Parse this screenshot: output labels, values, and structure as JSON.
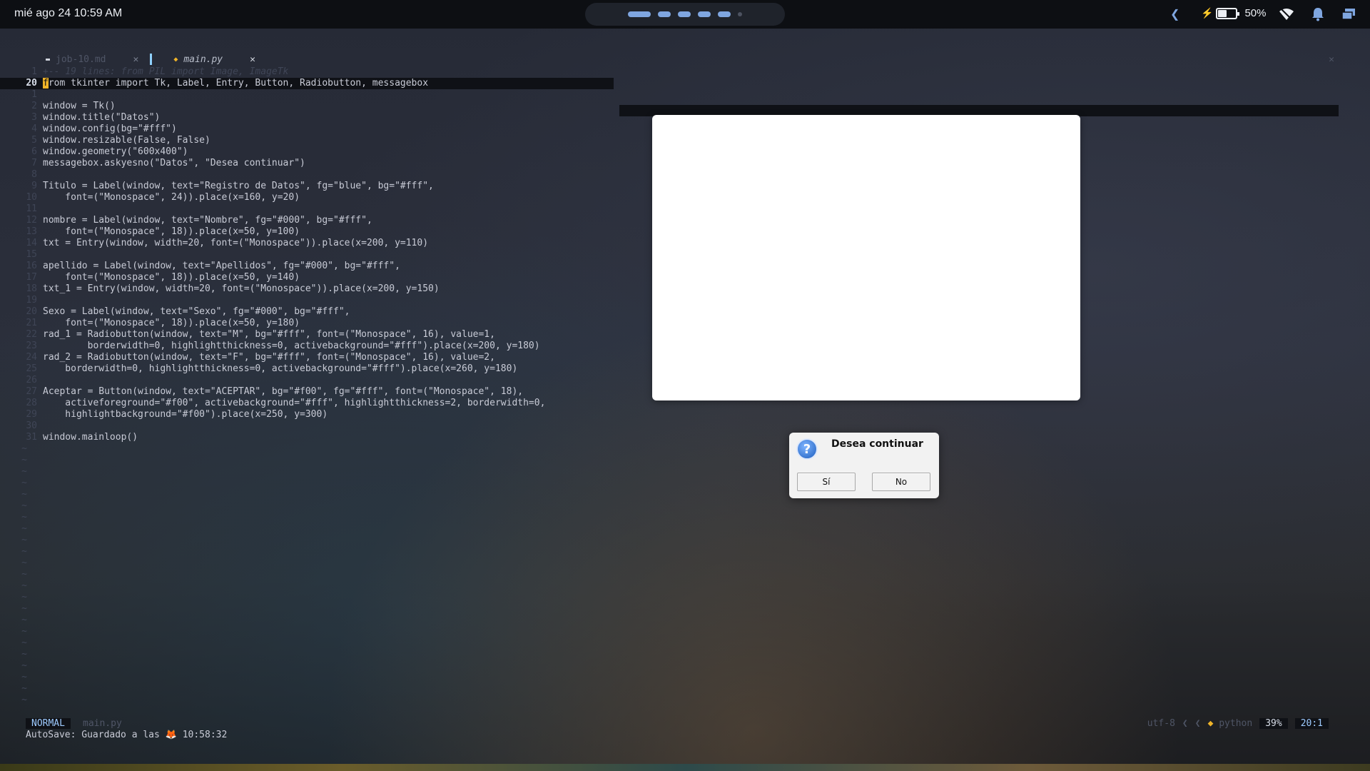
{
  "topbar": {
    "clock": "mié ago 24 10:59 AM",
    "battery_percent": "50%",
    "battery_level": 0.5,
    "workspaces": [
      "active",
      "normal",
      "normal",
      "normal",
      "normal",
      "empty"
    ]
  },
  "tabs": [
    {
      "label": "job-10.md",
      "close": "✕"
    },
    {
      "label": "main.py",
      "close": "✕"
    }
  ],
  "code_lines": [
    {
      "n": "1",
      "t": "+-- 19 lines: from PIL import Image, ImageTk",
      "folded": true
    },
    {
      "n": "20",
      "t": "from tkinter import Tk, Label, Entry, Button, Radiobutton, messagebox",
      "current": true
    },
    {
      "n": "1",
      "t": ""
    },
    {
      "n": "2",
      "t": "window = Tk()"
    },
    {
      "n": "3",
      "t": "window.title(\"Datos\")"
    },
    {
      "n": "4",
      "t": "window.config(bg=\"#fff\")"
    },
    {
      "n": "5",
      "t": "window.resizable(False, False)"
    },
    {
      "n": "6",
      "t": "window.geometry(\"600x400\")"
    },
    {
      "n": "7",
      "t": "messagebox.askyesno(\"Datos\", \"Desea continuar\")"
    },
    {
      "n": "8",
      "t": ""
    },
    {
      "n": "9",
      "t": "Titulo = Label(window, text=\"Registro de Datos\", fg=\"blue\", bg=\"#fff\","
    },
    {
      "n": "10",
      "t": "    font=(\"Monospace\", 24)).place(x=160, y=20)"
    },
    {
      "n": "11",
      "t": ""
    },
    {
      "n": "12",
      "t": "nombre = Label(window, text=\"Nombre\", fg=\"#000\", bg=\"#fff\","
    },
    {
      "n": "13",
      "t": "    font=(\"Monospace\", 18)).place(x=50, y=100)"
    },
    {
      "n": "14",
      "t": "txt = Entry(window, width=20, font=(\"Monospace\")).place(x=200, y=110)"
    },
    {
      "n": "15",
      "t": ""
    },
    {
      "n": "16",
      "t": "apellido = Label(window, text=\"Apellidos\", fg=\"#000\", bg=\"#fff\","
    },
    {
      "n": "17",
      "t": "    font=(\"Monospace\", 18)).place(x=50, y=140)"
    },
    {
      "n": "18",
      "t": "txt_1 = Entry(window, width=20, font=(\"Monospace\")).place(x=200, y=150)"
    },
    {
      "n": "19",
      "t": ""
    },
    {
      "n": "20",
      "t": "Sexo = Label(window, text=\"Sexo\", fg=\"#000\", bg=\"#fff\","
    },
    {
      "n": "21",
      "t": "    font=(\"Monospace\", 18)).place(x=50, y=180)"
    },
    {
      "n": "22",
      "t": "rad_1 = Radiobutton(window, text=\"M\", bg=\"#fff\", font=(\"Monospace\", 16), value=1,"
    },
    {
      "n": "23",
      "t": "        borderwidth=0, highlightthickness=0, activebackground=\"#fff\").place(x=200, y=180)"
    },
    {
      "n": "24",
      "t": "rad_2 = Radiobutton(window, text=\"F\", bg=\"#fff\", font=(\"Monospace\", 16), value=2,"
    },
    {
      "n": "25",
      "t": "    borderwidth=0, highlightthickness=0, activebackground=\"#fff\").place(x=260, y=180)"
    },
    {
      "n": "26",
      "t": ""
    },
    {
      "n": "27",
      "t": "Aceptar = Button(window, text=\"ACEPTAR\", bg=\"#f00\", fg=\"#fff\", font=(\"Monospace\", 18),"
    },
    {
      "n": "28",
      "t": "    activeforeground=\"#f00\", activebackground=\"#fff\", highlightthickness=2, borderwidth=0,"
    },
    {
      "n": "29",
      "t": "    highlightbackground=\"#f00\").place(x=250, y=300)"
    },
    {
      "n": "30",
      "t": ""
    },
    {
      "n": "31",
      "t": "window.mainloop()"
    }
  ],
  "tilde_rows": 23,
  "tilde": "~",
  "statusline": {
    "mode": "NORMAL",
    "file": "main.py",
    "encoding": "utf-8",
    "filetype": "python",
    "percent": "39%",
    "position": "20:1"
  },
  "cmdline": {
    "prefix": "AutoSave: Guardado a las",
    "emoji": "🦊",
    "time": "10:58:32"
  },
  "dialog": {
    "message": "Desea continuar",
    "icon": "?",
    "yes_label": "Sí",
    "no_label": "No"
  }
}
